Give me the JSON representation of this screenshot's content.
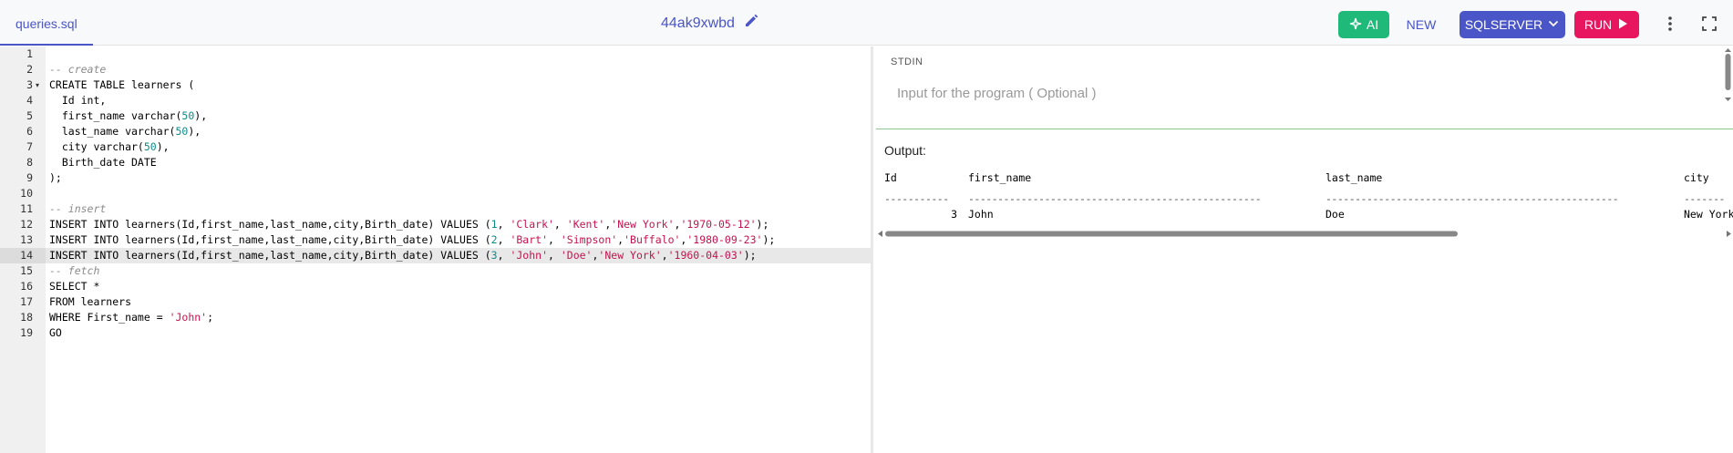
{
  "topbar": {
    "file_tab": "queries.sql",
    "share_id": "44ak9xwbd",
    "ai_label": "AI",
    "new_label": "NEW",
    "language_label": "SQLSERVER",
    "run_label": "RUN",
    "icons": [
      "edit-icon",
      "sparkle-icon",
      "chevron-down-icon",
      "play-icon",
      "kebab-menu-icon",
      "fullscreen-icon"
    ]
  },
  "colors": {
    "accent": "#4a55c8",
    "ai_green": "#1fb97a",
    "run_red": "#e8155f",
    "string": "#c4144d",
    "number": "#0e8a8a",
    "comment": "#8a8a8a"
  },
  "editor": {
    "active_line": 14,
    "lines": [
      {
        "n": "1",
        "tokens": []
      },
      {
        "n": "2",
        "tokens": [
          {
            "t": "-- create",
            "c": "cm"
          }
        ]
      },
      {
        "n": "3",
        "fold": true,
        "tokens": [
          {
            "t": "CREATE TABLE learners (",
            "c": "kw"
          }
        ]
      },
      {
        "n": "4",
        "tokens": [
          {
            "t": "  Id int,",
            "c": "kw"
          }
        ]
      },
      {
        "n": "5",
        "tokens": [
          {
            "t": "  first_name varchar(",
            "c": "kw"
          },
          {
            "t": "50",
            "c": "num"
          },
          {
            "t": "),",
            "c": "kw"
          }
        ]
      },
      {
        "n": "6",
        "tokens": [
          {
            "t": "  last_name varchar(",
            "c": "kw"
          },
          {
            "t": "50",
            "c": "num"
          },
          {
            "t": "),",
            "c": "kw"
          }
        ]
      },
      {
        "n": "7",
        "tokens": [
          {
            "t": "  city varchar(",
            "c": "kw"
          },
          {
            "t": "50",
            "c": "num"
          },
          {
            "t": "),",
            "c": "kw"
          }
        ]
      },
      {
        "n": "8",
        "tokens": [
          {
            "t": "  Birth_date DATE",
            "c": "kw"
          }
        ]
      },
      {
        "n": "9",
        "tokens": [
          {
            "t": ");",
            "c": "kw"
          }
        ]
      },
      {
        "n": "10",
        "tokens": []
      },
      {
        "n": "11",
        "tokens": [
          {
            "t": "-- insert",
            "c": "cm"
          }
        ]
      },
      {
        "n": "12",
        "tokens": [
          {
            "t": "INSERT INTO learners(Id,first_name,last_name,city,Birth_date) VALUES (",
            "c": "kw"
          },
          {
            "t": "1",
            "c": "num"
          },
          {
            "t": ", ",
            "c": "kw"
          },
          {
            "t": "'Clark'",
            "c": "str"
          },
          {
            "t": ", ",
            "c": "kw"
          },
          {
            "t": "'Kent'",
            "c": "str"
          },
          {
            "t": ",",
            "c": "kw"
          },
          {
            "t": "'New York'",
            "c": "str"
          },
          {
            "t": ",",
            "c": "kw"
          },
          {
            "t": "'1970-05-12'",
            "c": "str"
          },
          {
            "t": ");",
            "c": "kw"
          }
        ]
      },
      {
        "n": "13",
        "tokens": [
          {
            "t": "INSERT INTO learners(Id,first_name,last_name,city,Birth_date) VALUES (",
            "c": "kw"
          },
          {
            "t": "2",
            "c": "num"
          },
          {
            "t": ", ",
            "c": "kw"
          },
          {
            "t": "'Bart'",
            "c": "str"
          },
          {
            "t": ", ",
            "c": "kw"
          },
          {
            "t": "'Simpson'",
            "c": "str"
          },
          {
            "t": ",",
            "c": "kw"
          },
          {
            "t": "'Buffalo'",
            "c": "str"
          },
          {
            "t": ",",
            "c": "kw"
          },
          {
            "t": "'1980-09-23'",
            "c": "str"
          },
          {
            "t": ");",
            "c": "kw"
          }
        ]
      },
      {
        "n": "14",
        "tokens": [
          {
            "t": "INSERT INTO learners(Id,first_name,last_name,city,Birth_date) VALUES (",
            "c": "kw"
          },
          {
            "t": "3",
            "c": "num"
          },
          {
            "t": ", ",
            "c": "kw"
          },
          {
            "t": "'John'",
            "c": "str"
          },
          {
            "t": ", ",
            "c": "kw"
          },
          {
            "t": "'Doe'",
            "c": "str"
          },
          {
            "t": ",",
            "c": "kw"
          },
          {
            "t": "'New York'",
            "c": "str"
          },
          {
            "t": ",",
            "c": "kw"
          },
          {
            "t": "'1960-04-03'",
            "c": "str"
          },
          {
            "t": ");",
            "c": "kw"
          }
        ]
      },
      {
        "n": "15",
        "tokens": [
          {
            "t": "-- fetch",
            "c": "cm"
          }
        ]
      },
      {
        "n": "16",
        "tokens": [
          {
            "t": "SELECT *",
            "c": "kw"
          }
        ]
      },
      {
        "n": "17",
        "tokens": [
          {
            "t": "FROM learners",
            "c": "kw"
          }
        ]
      },
      {
        "n": "18",
        "tokens": [
          {
            "t": "WHERE First_name = ",
            "c": "kw"
          },
          {
            "t": "'John'",
            "c": "str"
          },
          {
            "t": ";",
            "c": "kw"
          }
        ]
      },
      {
        "n": "19",
        "tokens": [
          {
            "t": "GO",
            "c": "kw"
          }
        ]
      }
    ]
  },
  "stdin": {
    "label": "STDIN",
    "placeholder": "Input for the program ( Optional )",
    "value": ""
  },
  "output": {
    "label": "Output:",
    "headers": [
      "Id",
      "first_name",
      "last_name",
      "city"
    ],
    "separators": [
      "-----------",
      "--------------------------------------------------",
      "--------------------------------------------------",
      "-------"
    ],
    "rows": [
      [
        "3",
        "John",
        "Doe",
        "New York"
      ]
    ]
  }
}
